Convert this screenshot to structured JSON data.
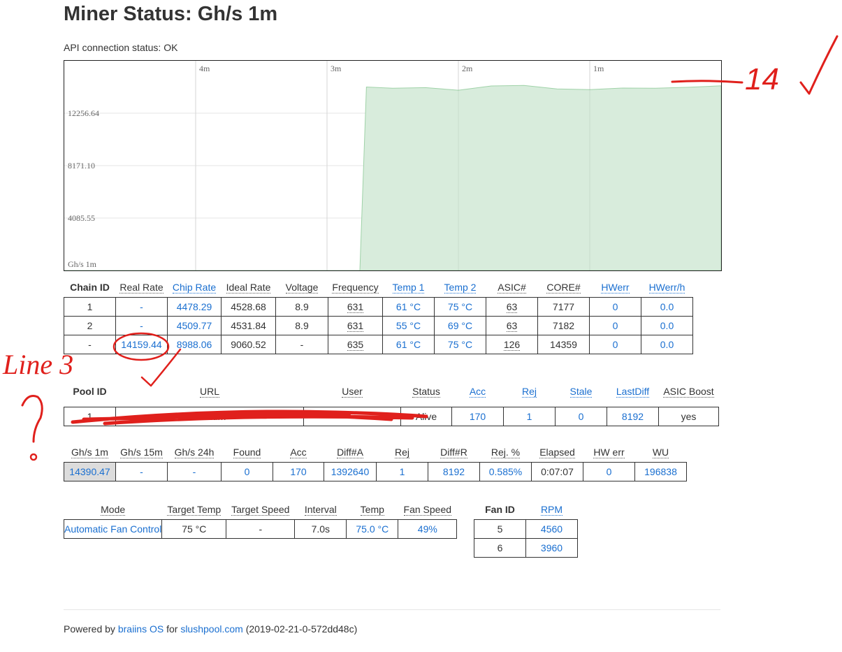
{
  "page": {
    "title": "Miner Status: Gh/s 1m",
    "api_status": "API connection status: OK"
  },
  "chart_data": {
    "type": "area",
    "ylabel": "Gh/s 1m",
    "y_ticks": [
      4085.55,
      8171.1,
      12256.64
    ],
    "x_ticks": [
      "4m",
      "3m",
      "2m",
      "1m"
    ],
    "x_minutes_ago": [
      5.0,
      2.75,
      2.7,
      2.5,
      2.25,
      2.0,
      1.75,
      1.5,
      1.25,
      1.0,
      0.75,
      0.5,
      0.25,
      0.0
    ],
    "y_values": [
      0,
      0,
      14300,
      14200,
      14250,
      14050,
      14380,
      14420,
      14150,
      14100,
      14220,
      14200,
      14280,
      14390.47
    ],
    "ylim": [
      0,
      16342
    ],
    "xlim_minutes_ago": [
      5.0,
      0.0
    ],
    "fill_color": "#d8ecdc",
    "line_color": "#9fd2a8"
  },
  "chains": {
    "headers": [
      {
        "label": "Chain ID",
        "style": "bold"
      },
      {
        "label": "Real Rate",
        "style": "dotted"
      },
      {
        "label": "Chip Rate",
        "style": "link"
      },
      {
        "label": "Ideal Rate",
        "style": "dotted"
      },
      {
        "label": "Voltage",
        "style": "dotted"
      },
      {
        "label": "Frequency",
        "style": "dotted"
      },
      {
        "label": "Temp 1",
        "style": "link"
      },
      {
        "label": "Temp 2",
        "style": "link"
      },
      {
        "label": "ASIC#",
        "style": "dotted"
      },
      {
        "label": "CORE#",
        "style": "dotted"
      },
      {
        "label": "HWerr",
        "style": "link"
      },
      {
        "label": "HWerr/h",
        "style": "link"
      }
    ],
    "rows": [
      [
        "1",
        "-",
        "4478.29",
        "4528.68",
        "8.9",
        "631",
        "61 °C",
        "75 °C",
        "63",
        "7177",
        "0",
        "0.0"
      ],
      [
        "2",
        "-",
        "4509.77",
        "4531.84",
        "8.9",
        "631",
        "55 °C",
        "69 °C",
        "63",
        "7182",
        "0",
        "0.0"
      ],
      [
        "-",
        "14159.44",
        "8988.06",
        "9060.52",
        "-",
        "635",
        "61 °C",
        "75 °C",
        "126",
        "14359",
        "0",
        "0.0"
      ]
    ]
  },
  "pools": {
    "headers": [
      {
        "label": "Pool ID",
        "style": "bold"
      },
      {
        "label": "URL",
        "style": "dotted"
      },
      {
        "label": "User",
        "style": "dotted"
      },
      {
        "label": "Status",
        "style": "dotted"
      },
      {
        "label": "Acc",
        "style": "link"
      },
      {
        "label": "Rej",
        "style": "link"
      },
      {
        "label": "Stale",
        "style": "link"
      },
      {
        "label": "LastDiff",
        "style": "link"
      },
      {
        "label": "ASIC Boost",
        "style": "dotted"
      }
    ],
    "rows": [
      [
        "1",
        "stratum",
        "",
        "Alive",
        "170",
        "1",
        "0",
        "8192",
        "yes"
      ]
    ]
  },
  "summary": {
    "headers": [
      {
        "label": "Gh/s 1m",
        "style": "dotted"
      },
      {
        "label": "Gh/s 15m",
        "style": "dotted"
      },
      {
        "label": "Gh/s 24h",
        "style": "dotted"
      },
      {
        "label": "Found",
        "style": "dotted"
      },
      {
        "label": "Acc",
        "style": "dotted"
      },
      {
        "label": "Diff#A",
        "style": "dotted"
      },
      {
        "label": "Rej",
        "style": "dotted"
      },
      {
        "label": "Diff#R",
        "style": "dotted"
      },
      {
        "label": "Rej. %",
        "style": "dotted"
      },
      {
        "label": "Elapsed",
        "style": "dotted"
      },
      {
        "label": "HW err",
        "style": "dotted"
      },
      {
        "label": "WU",
        "style": "dotted"
      }
    ],
    "rows": [
      [
        "14390.47",
        "-",
        "-",
        "0",
        "170",
        "1392640",
        "1",
        "8192",
        "0.585%",
        "0:07:07",
        "0",
        "196838"
      ]
    ]
  },
  "fan_control": {
    "headers": [
      {
        "label": "Mode",
        "style": "dotted"
      },
      {
        "label": "Target Temp",
        "style": "dotted"
      },
      {
        "label": "Target Speed",
        "style": "dotted"
      },
      {
        "label": "Interval",
        "style": "dotted"
      },
      {
        "label": "Temp",
        "style": "dotted"
      },
      {
        "label": "Fan Speed",
        "style": "dotted"
      }
    ],
    "rows": [
      [
        "Automatic Fan Control",
        "75 °C",
        "-",
        "7.0s",
        "75.0 °C",
        "49%"
      ]
    ]
  },
  "fans": {
    "headers": [
      {
        "label": "Fan ID",
        "style": "bold"
      },
      {
        "label": "RPM",
        "style": "link"
      }
    ],
    "rows": [
      [
        "5",
        "4560"
      ],
      [
        "6",
        "3960"
      ]
    ]
  },
  "footer": {
    "prefix": "Powered by ",
    "brand": "braiins OS",
    "middle": " for ",
    "site": "slushpool.com",
    "version": " (2019-02-21-0-572dd48c)"
  },
  "annotations": {
    "ink_color": "#e0201c",
    "chart_note": "14",
    "side_note": "Line 3",
    "question": "?"
  }
}
